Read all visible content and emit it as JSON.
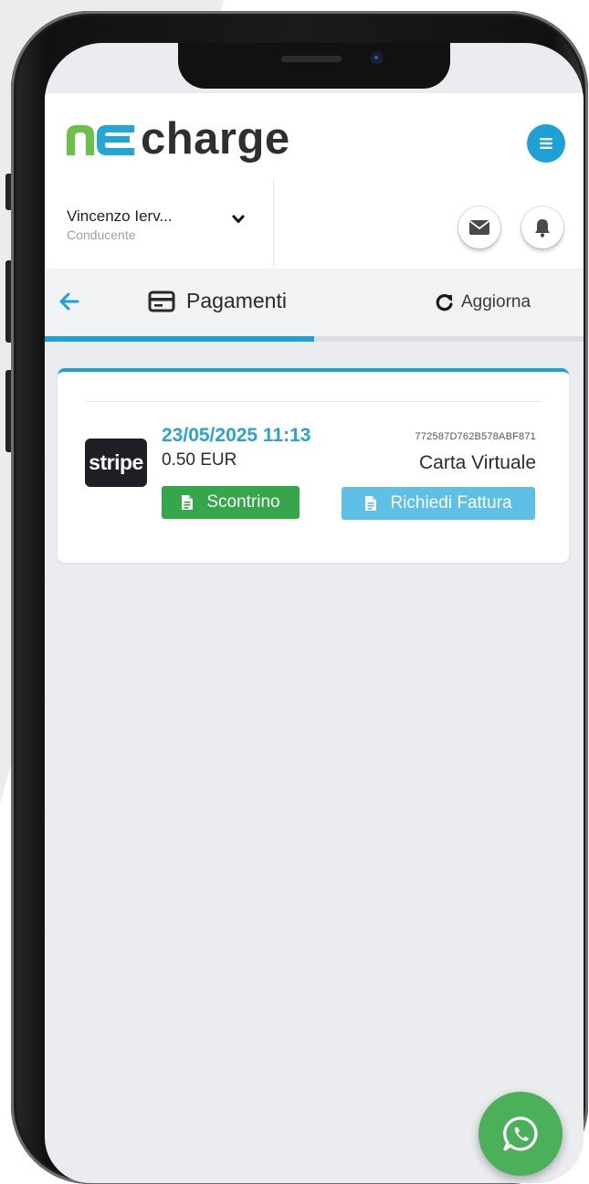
{
  "app": {
    "brand_name": "charge",
    "colors": {
      "accent": "#1e9fd8",
      "success": "#35a64a",
      "info": "#5ec0e6",
      "whatsapp": "#4caf5a"
    }
  },
  "user": {
    "name": "Vincenzo Ierv...",
    "role": "Conducente"
  },
  "toolbar": {
    "title": "Pagamenti",
    "refresh_label": "Aggiorna",
    "progress_fraction": 0.5
  },
  "payments": [
    {
      "provider": "stripe",
      "datetime": "23/05/2025 11:13",
      "amount": "0.50 EUR",
      "transaction_id": "772587D762B578ABF871",
      "method": "Carta Virtuale",
      "receipt_label": "Scontrino",
      "invoice_label": "Richiedi Fattura"
    }
  ],
  "icons": {
    "menu": "hamburger-menu-icon",
    "chevron": "chevron-down-icon",
    "mail": "envelope-icon",
    "bell": "bell-icon",
    "back": "arrow-left-icon",
    "payments": "credit-card-icon",
    "refresh": "refresh-icon",
    "document": "document-icon",
    "chat": "whatsapp-icon"
  }
}
